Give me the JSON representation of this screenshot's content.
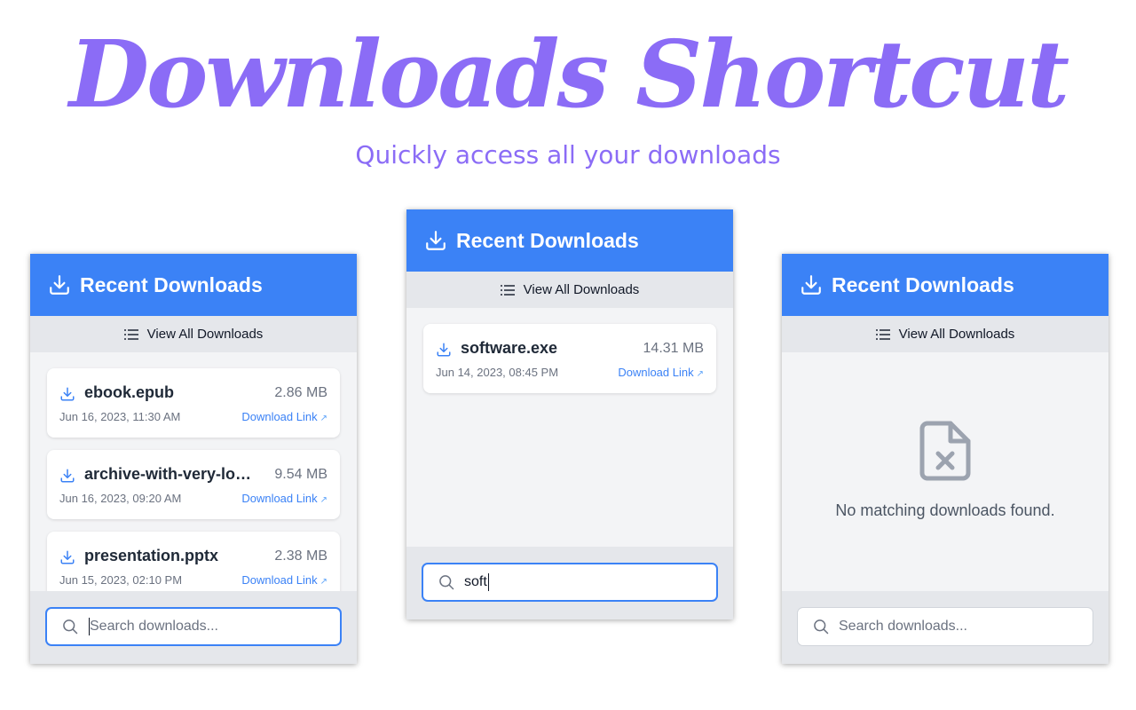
{
  "hero": {
    "title": "Downloads Shortcut",
    "subtitle": "Quickly access all your downloads"
  },
  "colors": {
    "accent": "#3b82f6",
    "hero": "#8b6cf6",
    "header_text": "#ffffff",
    "panel_bg": "#f3f4f6"
  },
  "panels": [
    {
      "header_title": "Recent Downloads",
      "view_all_label": "View All Downloads",
      "items": [
        {
          "name": "ebook.epub",
          "size": "2.86 MB",
          "date": "Jun 16, 2023, 11:30 AM",
          "link": "Download Link"
        },
        {
          "name": "archive-with-very-lo…",
          "size": "9.54 MB",
          "date": "Jun 16, 2023, 09:20 AM",
          "link": "Download Link"
        },
        {
          "name": "presentation.pptx",
          "size": "2.38 MB",
          "date": "Jun 15, 2023, 02:10 PM",
          "link": "Download Link"
        }
      ],
      "search": {
        "placeholder": "Search downloads...",
        "value": "",
        "focused": true
      }
    },
    {
      "header_title": "Recent Downloads",
      "view_all_label": "View All Downloads",
      "items": [
        {
          "name": "software.exe",
          "size": "14.31 MB",
          "date": "Jun 14, 2023, 08:45 PM",
          "link": "Download Link"
        }
      ],
      "search": {
        "placeholder": "Search downloads...",
        "value": "soft",
        "focused": true
      }
    },
    {
      "header_title": "Recent Downloads",
      "view_all_label": "View All Downloads",
      "items": [],
      "empty_message": "No matching downloads found.",
      "search": {
        "placeholder": "Search downloads...",
        "value": "",
        "focused": false
      }
    }
  ],
  "icons": {
    "header": "download-tray-icon",
    "view_all": "list-icon",
    "item": "download-icon",
    "link": "external-link-icon",
    "search": "search-icon",
    "empty": "file-x-icon"
  }
}
